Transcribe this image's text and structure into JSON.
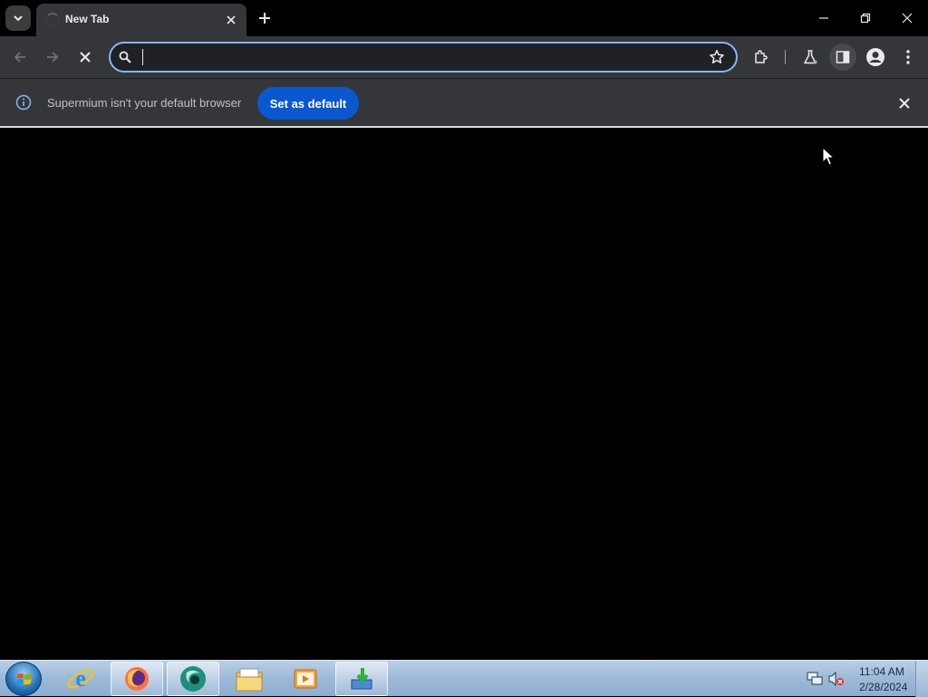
{
  "browser": {
    "tab": {
      "title": "New Tab"
    },
    "omnibox": {
      "value": "",
      "placeholder": ""
    },
    "infobar": {
      "message": "Supermium isn't your default browser",
      "button_label": "Set as default"
    },
    "colors": {
      "accent": "#8ab4f8",
      "button": "#0b57d0",
      "toolbar": "#35363a"
    }
  },
  "taskbar": {
    "apps": [
      {
        "name": "internet-explorer-icon"
      },
      {
        "name": "firefox-icon"
      },
      {
        "name": "supermium-icon"
      },
      {
        "name": "file-explorer-icon"
      },
      {
        "name": "media-player-icon"
      },
      {
        "name": "installer-icon"
      }
    ],
    "clock": {
      "time": "11:04 AM",
      "date": "2/28/2024"
    }
  }
}
